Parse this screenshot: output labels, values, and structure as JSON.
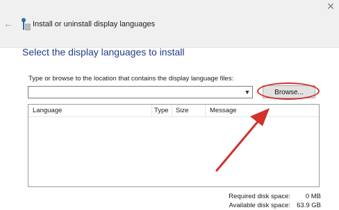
{
  "window": {
    "title": "Install or uninstall display languages",
    "close_glyph": "×",
    "back_glyph": "←"
  },
  "page": {
    "heading": "Select the display languages to install",
    "prompt": "Type or browse to the location that contains the display language files:",
    "path_value": "",
    "browse_label": "Browse..."
  },
  "list": {
    "columns": [
      "Language",
      "Type",
      "Size",
      "Message"
    ],
    "rows": []
  },
  "disk": {
    "required_label": "Required disk space:",
    "required_value": "0 MB",
    "available_label": "Available disk space:",
    "available_value": "63.9 GB"
  },
  "colors": {
    "heading": "#1f3c88",
    "annotation": "#d2312d"
  },
  "icons": {
    "app": "language-globe-icon",
    "back": "back-arrow-icon",
    "close": "close-icon",
    "dropdown": "chevron-down-icon"
  }
}
